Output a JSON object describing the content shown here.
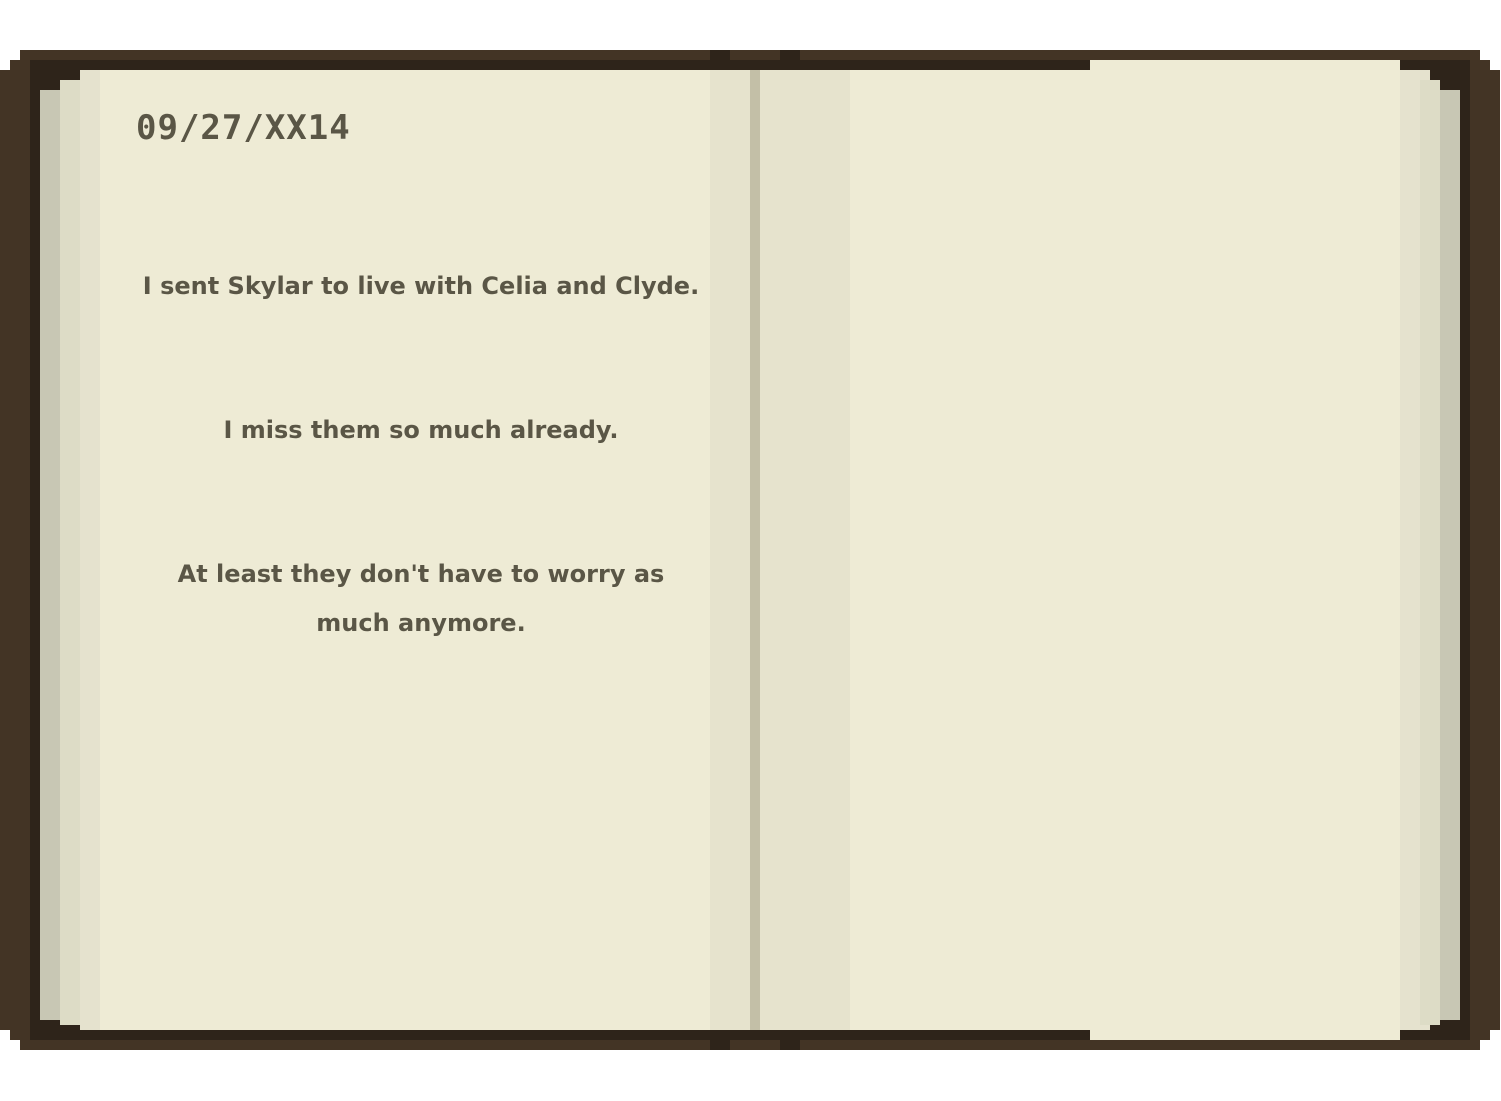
{
  "journal": {
    "date": "09/27/XX14",
    "paragraphs": [
      "I sent Skylar to live with Celia and Clyde.",
      "I miss them so much already.",
      "At least they don't have to worry as much anymore."
    ]
  },
  "colors": {
    "cover": "#433425",
    "paper": "#eeebd5",
    "ink": "#5a5646"
  }
}
